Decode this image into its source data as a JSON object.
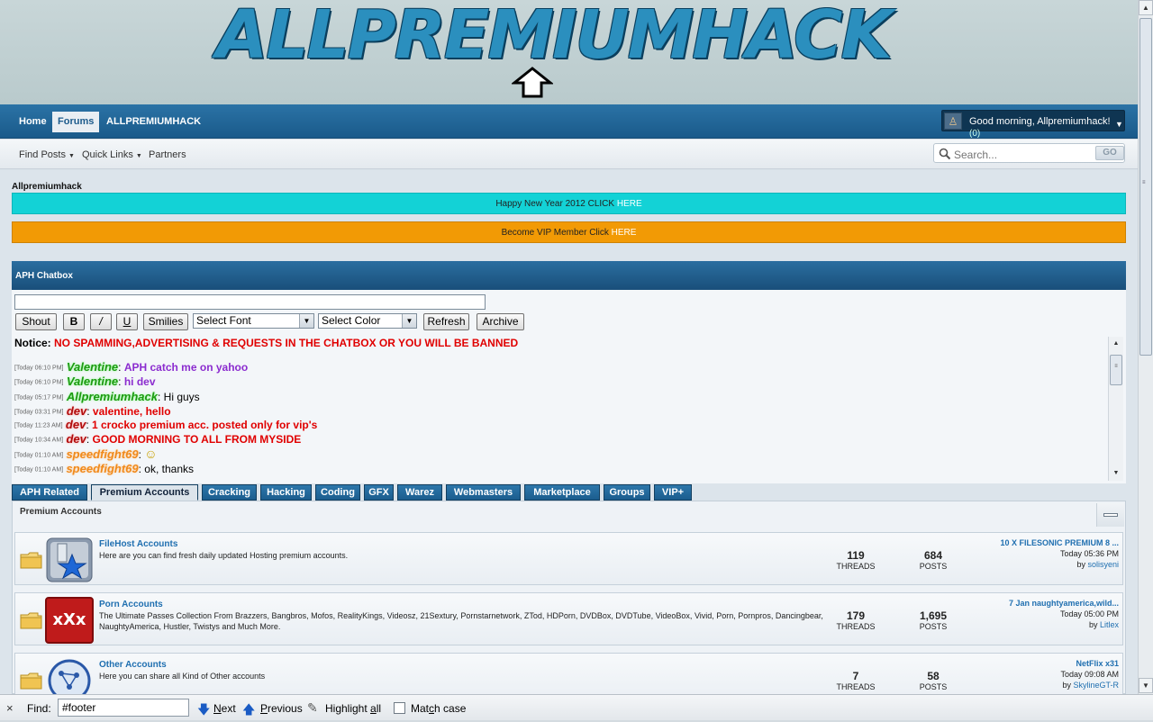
{
  "header": {
    "logo_text": "ALLPREMIUMHACK"
  },
  "nav": {
    "tabs": [
      {
        "label": "Home"
      },
      {
        "label": "Forums"
      },
      {
        "label": "ALLPREMIUMHACK"
      }
    ],
    "active_tab": "Forums",
    "user_greeting": "Good morning, Allpremiumhack!",
    "user_count": "(0)"
  },
  "subnav": {
    "links": [
      {
        "label": "Find Posts"
      },
      {
        "label": "Quick Links"
      },
      {
        "label": "Partners"
      }
    ],
    "search_placeholder": "Search...",
    "go_label": "GO"
  },
  "breadcrumb": "Allpremiumhack",
  "banners": {
    "new_year": {
      "text": "Happy New Year 2012 CLICK ",
      "link": "HERE"
    },
    "vip": {
      "text": "Become VIP Member Click ",
      "link": "HERE"
    }
  },
  "chatbox": {
    "title": "APH Chatbox",
    "buttons": {
      "shout": "Shout",
      "bold": "B",
      "italic": "/",
      "underline": "U",
      "smilies": "Smilies",
      "refresh": "Refresh",
      "archive": "Archive"
    },
    "font_select": "Select Font",
    "color_select": "Select Color",
    "notice_label": "Notice:",
    "notice_text": "NO SPAMMING,ADVERTISING & REQUESTS IN THE CHATBOX OR YOU WILL BE BANNED",
    "messages": [
      {
        "time": "[Today 06:10 PM]",
        "user": "Valentine",
        "text": "APH catch me on yahoo",
        "user_color": "green",
        "text_color": "#8b2ccf"
      },
      {
        "time": "[Today 06:10 PM]",
        "user": "Valentine",
        "text": "hi dev",
        "user_color": "green",
        "text_color": "#8b2ccf"
      },
      {
        "time": "[Today 05:17 PM]",
        "user": "Allpremiumhack",
        "text": "Hi guys",
        "user_color": "green",
        "text_color": "#000000"
      },
      {
        "time": "[Today 03:31 PM]",
        "user": "dev",
        "text": "valentine, hello",
        "user_color": "red",
        "text_color": "#e00000"
      },
      {
        "time": "[Today 11:23 AM]",
        "user": "dev",
        "text": "1 crocko premium acc. posted only for vip's",
        "user_color": "red",
        "text_color": "#e00000"
      },
      {
        "time": "[Today 10:34 AM]",
        "user": "dev",
        "text": "GOOD MORNING TO ALL FROM MYSIDE",
        "user_color": "red",
        "text_color": "#e00000"
      },
      {
        "time": "[Today 01:10 AM]",
        "user": "speedfight69",
        "text": "☺",
        "user_color": "orange",
        "text_color": "#c8a000"
      },
      {
        "time": "[Today 01:10 AM]",
        "user": "speedfight69",
        "text": "ok, thanks",
        "user_color": "orange",
        "text_color": "#000000"
      }
    ]
  },
  "category_tabs": [
    {
      "label": "APH Related"
    },
    {
      "label": "Premium Accounts"
    },
    {
      "label": "Cracking"
    },
    {
      "label": "Hacking"
    },
    {
      "label": "Coding"
    },
    {
      "label": "GFX"
    },
    {
      "label": "Warez"
    },
    {
      "label": "Webmasters"
    },
    {
      "label": "Marketplace"
    },
    {
      "label": "Groups"
    },
    {
      "label": "VIP+"
    }
  ],
  "active_category": "Premium Accounts",
  "forum_section": {
    "title": "Premium Accounts",
    "threads_label": "THREADS",
    "posts_label": "POSTS",
    "forums": [
      {
        "name": "FileHost Accounts",
        "description": "Here are you can find fresh daily updated Hosting premium accounts.",
        "threads": "119",
        "posts": "684",
        "last_title": "10 X FILESONIC PREMIUM 8 ...",
        "last_time": "Today 05:36 PM",
        "last_by": "by ",
        "last_user": "solisyeni",
        "icon": "filehost-star-icon"
      },
      {
        "name": "Porn Accounts",
        "description": "The Ultimate Passes Collection From Brazzers, Bangbros, Mofos, RealityKings, Videosz, 21Sextury, Pornstarnetwork, ZTod, HDPorn, DVDBox, DVDTube, VideoBox, Vivid, Porn, Pornpros, Dancingbear, NaughtyAmerica, Hustler, Twistys and Much More.",
        "threads": "179",
        "posts": "1,695",
        "last_title": "7 Jan naughtyamerica,wild...",
        "last_time": "Today 05:00 PM",
        "last_by": "by ",
        "last_user": "Litlex",
        "icon": "xxx-icon",
        "icon_text": "xXx"
      },
      {
        "name": "Other Accounts",
        "description": "Here you can share all Kind of Other accounts",
        "threads": "7",
        "posts": "58",
        "last_title": "NetFlix x31",
        "last_time": "Today 09:08 AM",
        "last_by": "by ",
        "last_user": "SkylineGT-R",
        "icon": "other-accounts-icon"
      }
    ]
  },
  "findbar": {
    "close": "×",
    "label": "Find:",
    "query": "#footer",
    "next_prefix": "",
    "next_u": "N",
    "next_rest": "ext",
    "prev_u": "P",
    "prev_rest": "revious",
    "highlight_prefix": "Highlight ",
    "highlight_u": "a",
    "highlight_rest": "ll",
    "match_prefix": "Mat",
    "match_u": "c",
    "match_rest": "h case"
  },
  "colors": {
    "nav_blue": "#1f63955",
    "cyan_banner": "#13d2d6",
    "orange_banner": "#f29a05",
    "link_blue": "#1f6fb0",
    "notice_red": "#e00000"
  }
}
